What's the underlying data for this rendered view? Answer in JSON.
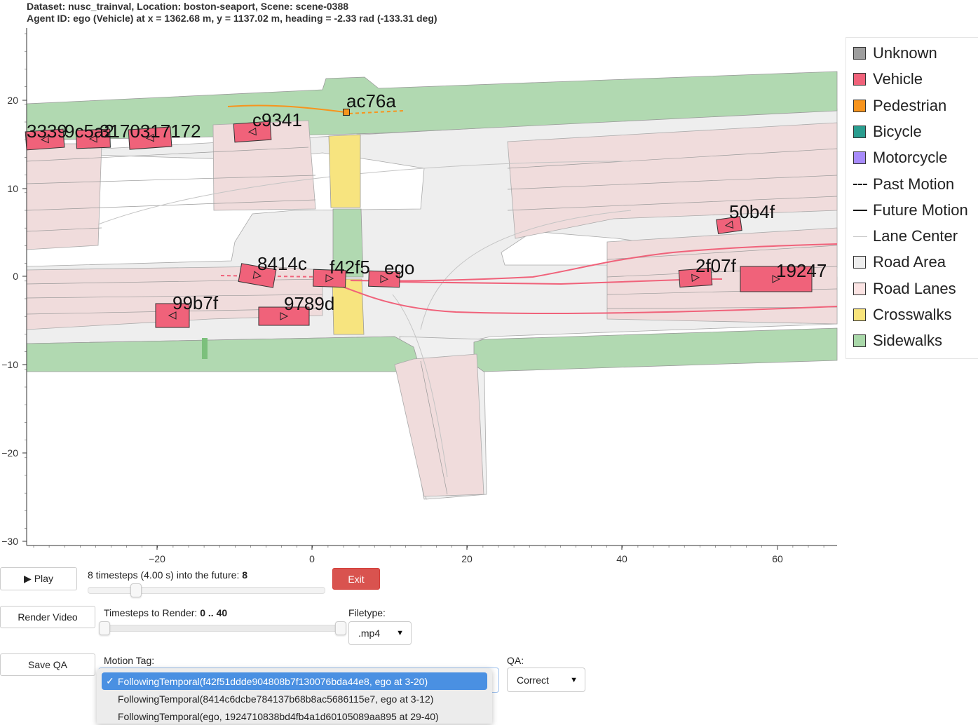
{
  "header": {
    "line1": "Dataset: nusc_trainval, Location: boston-seaport, Scene: scene-0388",
    "line2": "Agent ID: ego (Vehicle) at x = 1362.68 m, y = 1137.02 m, heading = -2.33 rad (-133.31 deg)"
  },
  "plot": {
    "x_ticks": [
      "−20",
      "0",
      "20",
      "40",
      "60"
    ],
    "y_ticks": [
      "20",
      "10",
      "0",
      "−10",
      "−20",
      "−30"
    ],
    "agent_labels": [
      "3339",
      "9c5a2",
      "3170317172",
      "c9341",
      "ac76a",
      "8414c",
      "f42f5",
      "ego",
      "99b7f",
      "9789d",
      "50b4f",
      "2f07f",
      "19247"
    ]
  },
  "legend": {
    "items": [
      {
        "label": "Unknown",
        "color": "#9e9e9e",
        "kind": "swatch"
      },
      {
        "label": "Vehicle",
        "color": "#f0627a",
        "kind": "swatch"
      },
      {
        "label": "Pedestrian",
        "color": "#f7941d",
        "kind": "swatch"
      },
      {
        "label": "Bicycle",
        "color": "#2a9d8f",
        "kind": "swatch"
      },
      {
        "label": "Motorcycle",
        "color": "#a78bfa",
        "kind": "swatch"
      },
      {
        "label": "Past Motion",
        "color": "#000000",
        "kind": "dashed"
      },
      {
        "label": "Future Motion",
        "color": "#000000",
        "kind": "solid"
      },
      {
        "label": "Lane Center",
        "color": "#c8c8c8",
        "kind": "thin"
      },
      {
        "label": "Road Area",
        "color": "#eeeeee",
        "kind": "swatch"
      },
      {
        "label": "Road Lanes",
        "color": "#fbe3e3",
        "kind": "swatch"
      },
      {
        "label": "Crosswalks",
        "color": "#f8e47c",
        "kind": "swatch"
      },
      {
        "label": "Sidewalks",
        "color": "#a9d8a9",
        "kind": "swatch"
      }
    ]
  },
  "controls": {
    "play_label": "▶ Play",
    "future_label": "8 timesteps (4.00 s) into the future:",
    "future_value": "8",
    "exit_label": "Exit",
    "render_label": "Render Video",
    "render_range_label": "Timesteps to Render:",
    "render_range_value": "0 .. 40",
    "filetype_label": "Filetype:",
    "filetype_value": ".mp4",
    "save_label": "Save QA",
    "motion_tag_label": "Motion Tag:",
    "qa_label": "QA:",
    "qa_value": "Correct",
    "motion_options": [
      "FollowingTemporal(f42f51ddde904808b7f130076bda44e8, ego at 3-20)",
      "FollowingTemporal(8414c6dcbe784137b68b8ac5686115e7, ego at 3-12)",
      "FollowingTemporal(ego, 1924710838bd4fb4a1d60105089aa895 at 29-40)"
    ],
    "check_glyph": "✓"
  }
}
